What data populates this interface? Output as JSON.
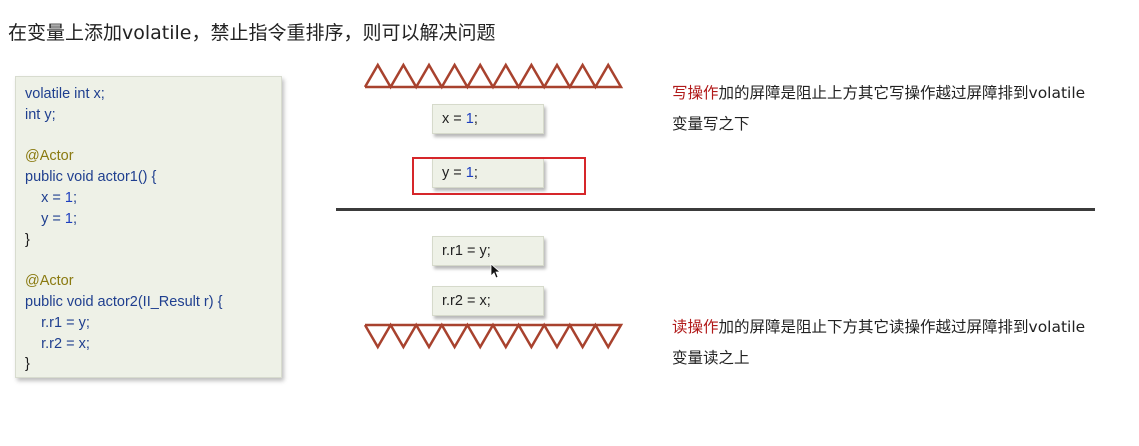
{
  "title": "在变量上添加volatile，禁止指令重排序，则可以解决问题",
  "code_lines": [
    [
      {
        "t": "volatile int x;",
        "c": "kw"
      }
    ],
    [
      {
        "t": "int y;",
        "c": "kw"
      }
    ],
    [
      {
        "t": "",
        "c": ""
      }
    ],
    [
      {
        "t": "@Actor",
        "c": "ann"
      }
    ],
    [
      {
        "t": "public void actor1() {",
        "c": "kw"
      }
    ],
    [
      {
        "t": "    x = ",
        "c": "kw"
      },
      {
        "t": "1",
        "c": "num"
      },
      {
        "t": ";",
        "c": "kw"
      }
    ],
    [
      {
        "t": "    y = ",
        "c": "kw"
      },
      {
        "t": "1",
        "c": "num"
      },
      {
        "t": ";",
        "c": "kw"
      }
    ],
    [
      {
        "t": "}",
        "c": ""
      }
    ],
    [
      {
        "t": "",
        "c": ""
      }
    ],
    [
      {
        "t": "@Actor",
        "c": "ann"
      }
    ],
    [
      {
        "t": "public void actor2(II_Result r) {",
        "c": "kw"
      }
    ],
    [
      {
        "t": "    r.r1 = y;",
        "c": "kw"
      }
    ],
    [
      {
        "t": "    r.r2 = x;",
        "c": "kw"
      }
    ],
    [
      {
        "t": "}",
        "c": ""
      }
    ]
  ],
  "statements": {
    "x_assign": {
      "pre": "x = ",
      "num": "1",
      "post": ";"
    },
    "y_assign": {
      "pre": "y = ",
      "num": "1",
      "post": ";"
    },
    "r1_read": "r.r1 = y;",
    "r2_read": "r.r2 = x;"
  },
  "notes": {
    "write_red": "写操作",
    "write_rest": "加的屏障是阻止上方其它写操作越过屏障排到volatile变量写之下",
    "read_red": "读操作",
    "read_rest": "加的屏障是阻止下方其它读操作越过屏障排到volatile变量读之上"
  },
  "colors": {
    "barrier": "#a8422e",
    "highlight": "#d6262a",
    "note_accent": "#b11a1a",
    "code_bg": "#eef1e7"
  }
}
